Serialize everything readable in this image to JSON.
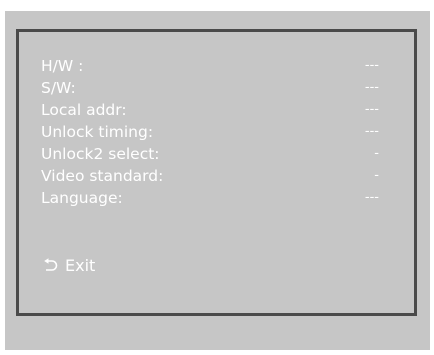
{
  "info_rows": [
    {
      "label": "H/W :",
      "value": "---"
    },
    {
      "label": "S/W:",
      "value": "---"
    },
    {
      "label": "Local addr:",
      "value": "---"
    },
    {
      "label": "Unlock timing:",
      "value": "---"
    },
    {
      "label": "Unlock2 select:",
      "value": "-"
    },
    {
      "label": "Video standard:",
      "value": "-"
    },
    {
      "label": "Language:",
      "value": "---"
    }
  ],
  "exit": {
    "label": "Exit",
    "icon": "back-arrow-icon"
  },
  "colors": {
    "screen_background": "#c6c6c6",
    "panel_border": "#4a4a4a",
    "text": "#ffffff"
  }
}
